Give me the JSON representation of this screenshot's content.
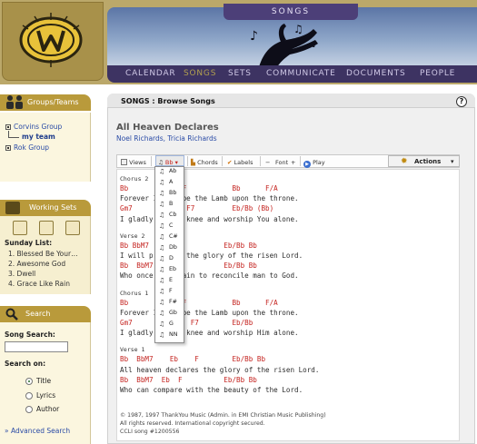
{
  "header": {
    "section_title": "SONGS",
    "nav": [
      "CALENDAR",
      "SONGS",
      "SETS",
      "COMMUNICATE",
      "DOCUMENTS",
      "PEOPLE"
    ],
    "active_nav": "SONGS"
  },
  "sidebar": {
    "groups": {
      "title": "Groups/Teams",
      "items": [
        "Corvins Group",
        "my team",
        "Rok Group"
      ]
    },
    "working_sets": {
      "title": "Working Sets",
      "list_title": "Sunday List:",
      "items": [
        "1. Blessed Be Your…",
        "2. Awesome God",
        "3. Dwell",
        "4. Grace Like Rain"
      ]
    },
    "search": {
      "title": "Search",
      "song_search_label": "Song Search:",
      "song_search_value": "",
      "search_on_label": "Search on:",
      "options": [
        "Title",
        "Lyrics",
        "Author"
      ],
      "selected_option": "Title",
      "advanced_link": "» Advanced Search"
    }
  },
  "main": {
    "browse_title": "SONGS : Browse Songs",
    "help_label": "?",
    "song_title": "All Heaven Declares",
    "authors": "Noel Richards, Tricia Richards",
    "toolbar": {
      "views": "Views",
      "key": "Bb",
      "chords": "Chords",
      "labels": "Labels",
      "font_minus": "−",
      "font": "Font",
      "font_plus": "+",
      "play": "Play",
      "actions": "Actions"
    },
    "chart_lines": [
      {
        "t": "section",
        "text": "Chorus 2"
      },
      {
        "t": "chord",
        "text": "Bb          Eb F           Bb      F/A"
      },
      {
        "t": "lyric",
        "text": "Forever I will be the Lamb upon the throne."
      },
      {
        "t": "chord",
        "text": "Gm7         Eb  F7         Eb/Bb (Bb)"
      },
      {
        "t": "lyric",
        "text": "I gladly bow my knee and worship You alone."
      },
      {
        "t": "blank",
        "text": ""
      },
      {
        "t": "section",
        "text": "Verse 2"
      },
      {
        "t": "chord",
        "text": "Bb BbM7   Eb  F          Eb/Bb Bb"
      },
      {
        "t": "lyric",
        "text": "I will proclaim the glory of the risen Lord."
      },
      {
        "t": "chord",
        "text": "Bb  BbM7  Eb  F          Eb/Bb Bb"
      },
      {
        "t": "lyric",
        "text": "Who once was slain to reconcile man to God."
      },
      {
        "t": "blank",
        "text": ""
      },
      {
        "t": "section",
        "text": "Chorus 1"
      },
      {
        "t": "chord",
        "text": "Bb          Eb F           Bb      F/A"
      },
      {
        "t": "lyric",
        "text": "Forever I will be the Lamb upon the throne."
      },
      {
        "t": "chord",
        "text": "Gm7         Eb   F7        Eb/Bb"
      },
      {
        "t": "lyric",
        "text": "I gladly bow my knee and worship Him alone."
      },
      {
        "t": "blank",
        "text": ""
      },
      {
        "t": "section",
        "text": "Verse 1"
      },
      {
        "t": "chord",
        "text": "Bb  BbM7    Eb    F        Eb/Bb Bb"
      },
      {
        "t": "lyric",
        "text": "All heaven declares the glory of the risen Lord."
      },
      {
        "t": "chord",
        "text": "Bb  BbM7  Eb  F          Eb/Bb Bb"
      },
      {
        "t": "lyric",
        "text": "Who can compare with the beauty of the Lord."
      }
    ],
    "copyright": [
      "© 1987, 1997 ThankYou Music (Admin. in EMI Christian Music Publishing)",
      "All rights reserved. International copyright secured.",
      "CCLI song #1200556"
    ],
    "key_options": [
      "Ab",
      "A",
      "Bb",
      "B",
      "Cb",
      "C",
      "C#",
      "Db",
      "D",
      "Eb",
      "E",
      "F",
      "F#",
      "Gb",
      "G",
      "NN"
    ]
  },
  "colors": {
    "chord": "#c4231f",
    "nav_bg": "#3d3362",
    "nav_active": "#b3a04f",
    "panel_head": "#b99a3b",
    "link": "#2a4ba6"
  }
}
